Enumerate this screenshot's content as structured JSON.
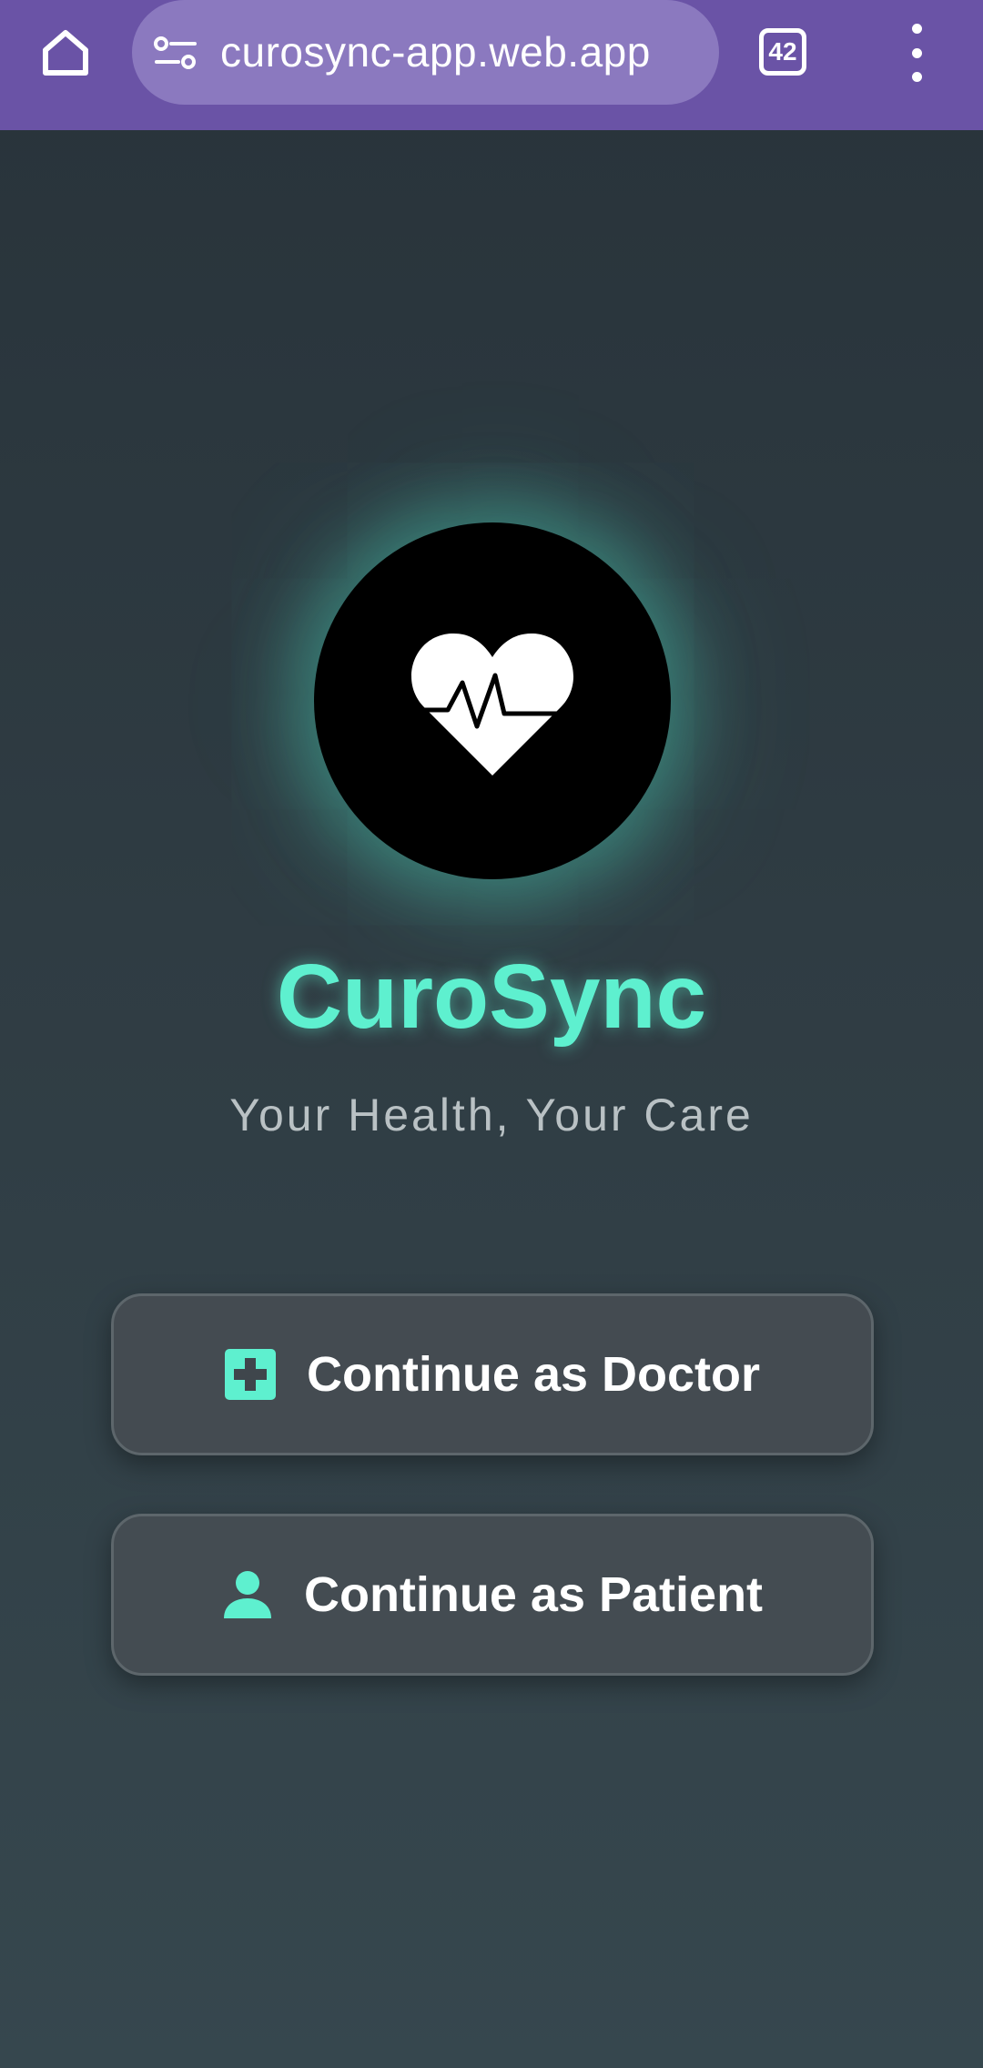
{
  "browser": {
    "url": "curosync-app.web.app",
    "tab_count": "42"
  },
  "app": {
    "name": "CuroSync",
    "tagline": "Your Health, Your Care"
  },
  "actions": {
    "doctor_label": "Continue as Doctor",
    "patient_label": "Continue as Patient"
  },
  "colors": {
    "accent": "#5ef0cf",
    "browser_bar": "#6a53a6",
    "background_top": "#28333a",
    "background_bottom": "#36474e"
  },
  "icons": {
    "home": "home-icon",
    "site_info": "tune-icon",
    "tabs": "tabs-counter-icon",
    "menu": "more-vert-icon",
    "logo": "heart-pulse-icon",
    "doctor": "medical-cross-icon",
    "patient": "person-icon"
  }
}
